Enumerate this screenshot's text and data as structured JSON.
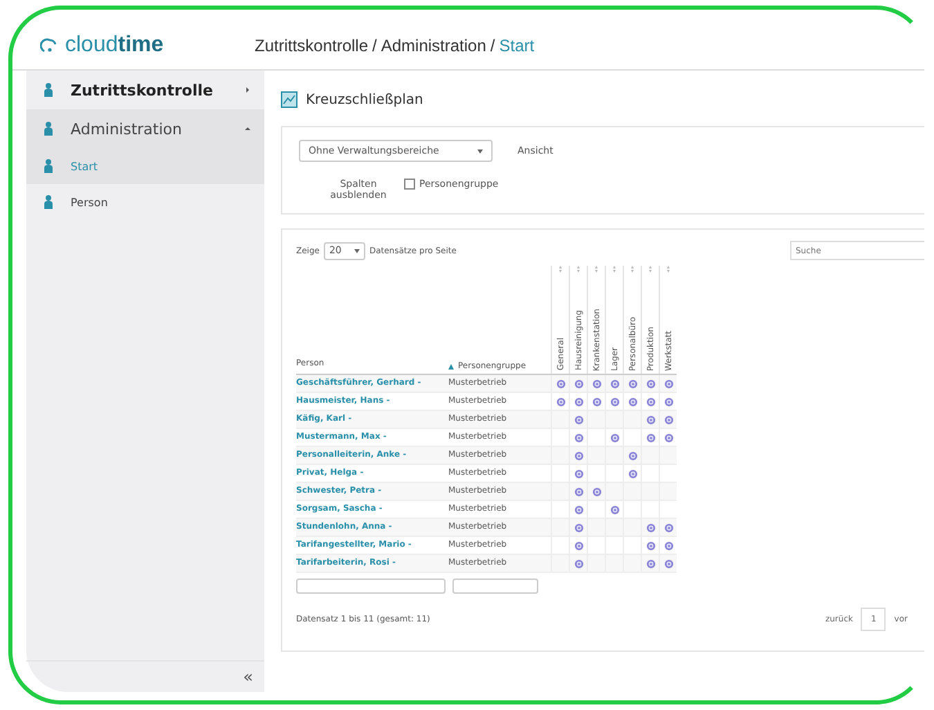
{
  "logo": "cloud**time**",
  "breadcrumb": {
    "separator": "/",
    "items": [
      {
        "label": "Zutrittskontrolle",
        "current": false
      },
      {
        "label": "Administration",
        "current": false
      },
      {
        "label": "Start",
        "current": true
      }
    ]
  },
  "sidebar": {
    "items": [
      {
        "label": "Zutrittskontrolle",
        "kind": "top",
        "expanded": false
      },
      {
        "label": "Administration",
        "kind": "top",
        "expanded": true
      },
      {
        "label": "Start",
        "kind": "sub",
        "selected": true
      },
      {
        "label": "Person",
        "kind": "sub",
        "selected": false
      }
    ],
    "collapse": "«"
  },
  "page_title": "Kreuzschließplan",
  "filter": {
    "select": "Ohne Verwaltungsbereiche",
    "view_label": "Ansicht",
    "hide_label": "Spalten ausblenden",
    "checkboxes": [
      {
        "label": "Personengruppe",
        "checked": false
      }
    ]
  },
  "table": {
    "show_label": "Zeige",
    "page_size": "20",
    "per_page_label": "Datensätze pro Seite",
    "search_placeholder": "Suche",
    "columns": [
      "Person",
      "Personengruppe"
    ],
    "matrix_columns": [
      "General",
      "Hausreinigung",
      "Krankenstation",
      "Lager",
      "Personalbüro",
      "Produktion",
      "Werkstatt"
    ],
    "rows": [
      {
        "person": "Geschäftsführer, Gerhard -",
        "group": "Musterbetrieb",
        "access": [
          true,
          true,
          true,
          true,
          true,
          true,
          true
        ]
      },
      {
        "person": "Hausmeister, Hans -",
        "group": "Musterbetrieb",
        "access": [
          true,
          true,
          true,
          true,
          true,
          true,
          true
        ]
      },
      {
        "person": "Käfig, Karl -",
        "group": "Musterbetrieb",
        "access": [
          false,
          true,
          false,
          false,
          false,
          true,
          true
        ]
      },
      {
        "person": "Mustermann, Max -",
        "group": "Musterbetrieb",
        "access": [
          false,
          true,
          false,
          true,
          false,
          true,
          true
        ]
      },
      {
        "person": "Personalleiterin, Anke -",
        "group": "Musterbetrieb",
        "access": [
          false,
          true,
          false,
          false,
          true,
          false,
          false
        ]
      },
      {
        "person": "Privat, Helga -",
        "group": "Musterbetrieb",
        "access": [
          false,
          true,
          false,
          false,
          true,
          false,
          false
        ]
      },
      {
        "person": "Schwester, Petra -",
        "group": "Musterbetrieb",
        "access": [
          false,
          true,
          true,
          false,
          false,
          false,
          false
        ]
      },
      {
        "person": "Sorgsam, Sascha -",
        "group": "Musterbetrieb",
        "access": [
          false,
          true,
          false,
          true,
          false,
          false,
          false
        ]
      },
      {
        "person": "Stundenlohn, Anna -",
        "group": "Musterbetrieb",
        "access": [
          false,
          true,
          false,
          false,
          false,
          true,
          true
        ]
      },
      {
        "person": "Tarifangestellter, Mario -",
        "group": "Musterbetrieb",
        "access": [
          false,
          true,
          false,
          false,
          false,
          true,
          true
        ]
      },
      {
        "person": "Tarifarbeiterin, Rosi -",
        "group": "Musterbetrieb",
        "access": [
          false,
          true,
          false,
          false,
          false,
          true,
          true
        ]
      }
    ],
    "info": "Datensatz 1 bis 11 (gesamt: 11)",
    "pagination": [
      {
        "label": "zurück",
        "selected": false
      },
      {
        "label": "1",
        "selected": true
      },
      {
        "label": "vor",
        "selected": false
      }
    ]
  }
}
